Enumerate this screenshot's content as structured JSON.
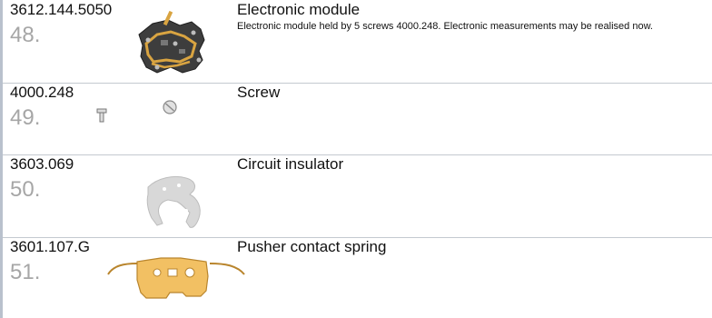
{
  "rows": [
    {
      "part": "3612.144.5050",
      "step": "48.",
      "title": "Electronic module",
      "description": "Electronic module held by 5 screws 4000.248. Electronic measurements may be realised now.",
      "icon": "electronic-module"
    },
    {
      "part": "4000.248",
      "step": "49.",
      "title": "Screw",
      "description": "",
      "icon": "screw"
    },
    {
      "part": "3603.069",
      "step": "50.",
      "title": "Circuit insulator",
      "description": "",
      "icon": "circuit-insulator"
    },
    {
      "part": "3601.107.G",
      "step": "51.",
      "title": "Pusher contact spring",
      "description": "",
      "icon": "pusher-contact-spring"
    }
  ],
  "colors": {
    "left_rule": "#b9c1cd",
    "divider": "#c4c9d0",
    "step_number": "#a6a6a6",
    "gold_part": "#f2c063",
    "gold_outline": "#b9852d",
    "insulator": "#d8d8d8"
  }
}
